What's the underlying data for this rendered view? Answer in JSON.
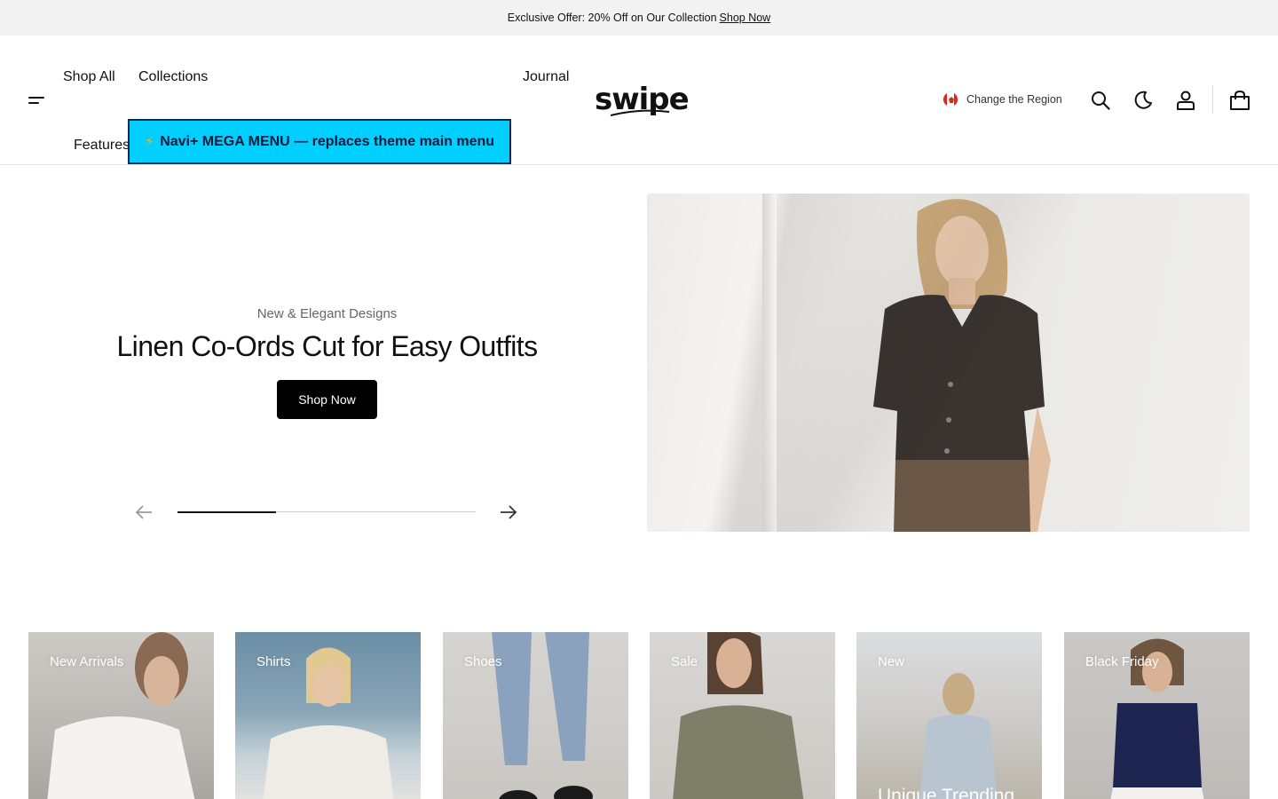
{
  "announcement": {
    "text": "Exclusive Offer: 20% Off on Our Collection",
    "link": "Shop Now"
  },
  "header": {
    "nav": {
      "shop_all": "Shop All",
      "collections": "Collections",
      "journal": "Journal",
      "features": "Features"
    },
    "mega_banner": {
      "icon": "lightning-bolt",
      "text": "Navi+ MEGA MENU — replaces theme main menu"
    },
    "logo": "swipe",
    "region": {
      "flag": "canada-flag",
      "label": "Change the Region"
    },
    "icons": [
      "search-icon",
      "moon-icon",
      "account-icon",
      "cart-icon"
    ]
  },
  "hero": {
    "subtitle": "New & Elegant Designs",
    "title": "Linen Co-Ords Cut for Easy Outfits",
    "button": "Shop Now",
    "slider": {
      "progress": 0.33
    }
  },
  "categories": [
    {
      "label": "New Arrivals"
    },
    {
      "label": "Shirts"
    },
    {
      "label": "Shoes"
    },
    {
      "label": "Sale"
    },
    {
      "label": "New",
      "overlay": "Unique Trending"
    },
    {
      "label": "Black Friday"
    }
  ],
  "colors": {
    "accent": "#00cfff",
    "primary": "#000000",
    "announcement_bg": "#f2f2f2",
    "flag_red": "#d52b1e"
  }
}
